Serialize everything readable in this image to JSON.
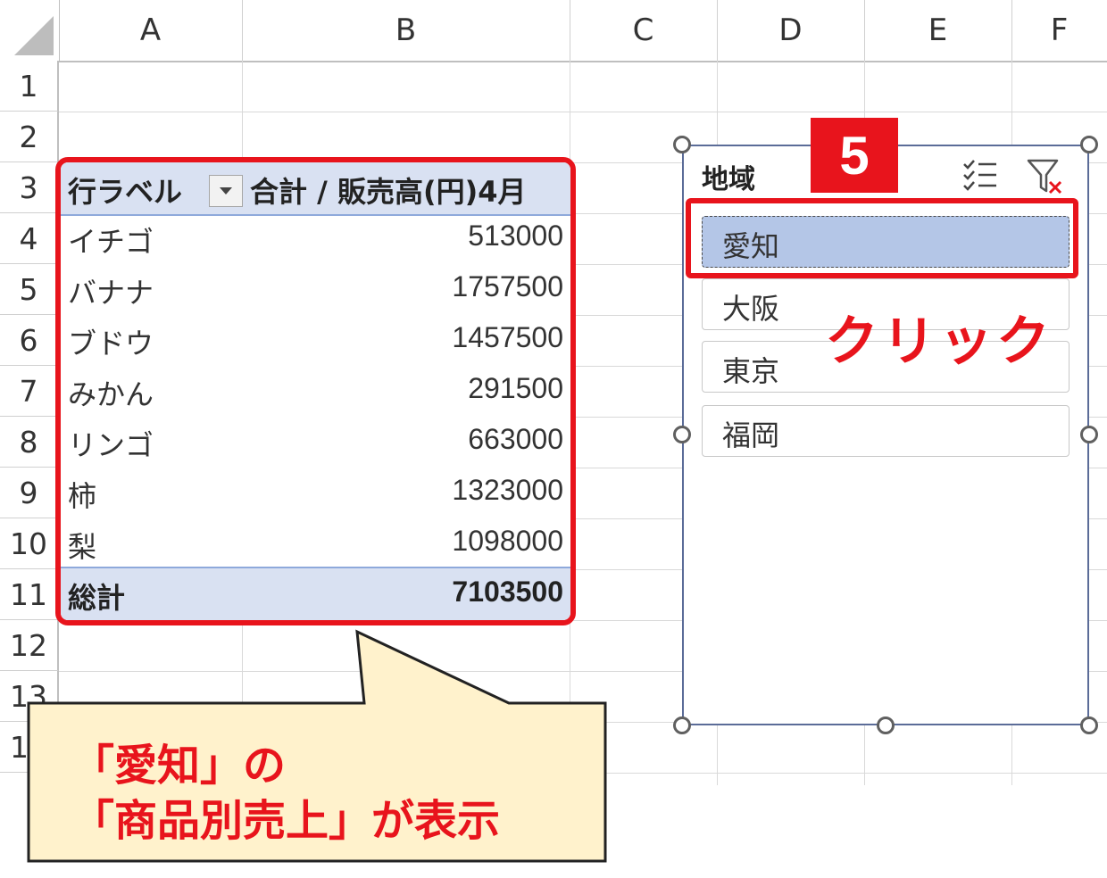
{
  "columns": [
    "A",
    "B",
    "C",
    "D",
    "E",
    "F"
  ],
  "rows": [
    "1",
    "2",
    "3",
    "4",
    "5",
    "6",
    "7",
    "8",
    "9",
    "10",
    "11",
    "12",
    "13",
    "14"
  ],
  "pivot": {
    "row_label_header": "行ラベル",
    "value_header": "合計 / 販売高(円)4月",
    "items": [
      {
        "name": "イチゴ",
        "value": "513000"
      },
      {
        "name": "バナナ",
        "value": "1757500"
      },
      {
        "name": "ブドウ",
        "value": "1457500"
      },
      {
        "name": "みかん",
        "value": "291500"
      },
      {
        "name": "リンゴ",
        "value": "663000"
      },
      {
        "name": "柿",
        "value": "1323000"
      },
      {
        "name": "梨",
        "value": "1098000"
      }
    ],
    "total_label": "総計",
    "total_value": "7103500"
  },
  "slicer": {
    "title": "地域",
    "items": [
      {
        "label": "愛知",
        "selected": true
      },
      {
        "label": "大阪",
        "selected": false
      },
      {
        "label": "東京",
        "selected": false
      },
      {
        "label": "福岡",
        "selected": false
      }
    ]
  },
  "annotations": {
    "step_number": "5",
    "click_label": "クリック",
    "callout_line1": "「愛知」の",
    "callout_line2": "「商品別売上」が表示"
  },
  "colors": {
    "accent_red": "#e8141c",
    "pivot_header_bg": "#d9e1f2",
    "slicer_selected_bg": "#b4c6e7",
    "callout_bg": "#fff2cc"
  }
}
